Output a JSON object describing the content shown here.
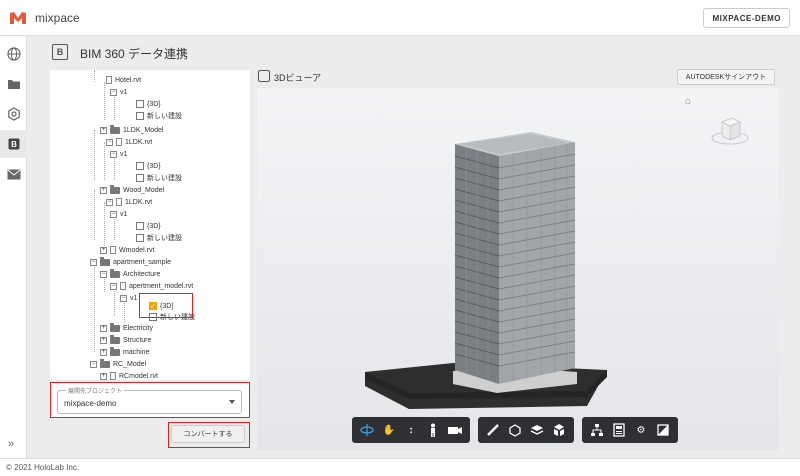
{
  "app": {
    "name": "mixpace",
    "account_button": "MIXPACE-DEMO"
  },
  "rail": {
    "items": [
      "globe-icon",
      "folder-icon",
      "settings-icon",
      "bim360-icon",
      "mail-icon"
    ],
    "expand_label": "»"
  },
  "page": {
    "icon_letter": "B",
    "title": "BIM 360 データ連携"
  },
  "tree": {
    "rows": [
      {
        "kind": "file",
        "label": "Hotel.rvt"
      },
      {
        "kind": "version",
        "label": "v1"
      },
      {
        "kind": "check",
        "label": "{3D}"
      },
      {
        "kind": "check",
        "label": "新しい建設"
      },
      {
        "kind": "folder",
        "label": "1LDK_Model"
      },
      {
        "kind": "file",
        "label": "1LDK.rvt"
      },
      {
        "kind": "version",
        "label": "v1"
      },
      {
        "kind": "check",
        "label": "{3D}"
      },
      {
        "kind": "check",
        "label": "新しい建設"
      },
      {
        "kind": "folder",
        "label": "Wood_Model"
      },
      {
        "kind": "file",
        "label": "1LDK.rvt"
      },
      {
        "kind": "version",
        "label": "v1"
      },
      {
        "kind": "check",
        "label": "{3D}"
      },
      {
        "kind": "check",
        "label": "新しい建設"
      },
      {
        "kind": "file",
        "label": "Wmodel.rvt"
      },
      {
        "kind": "folder",
        "label": "apartment_sample"
      },
      {
        "kind": "folder",
        "label": "Architecture"
      },
      {
        "kind": "file",
        "label": "apertment_model.rvt"
      },
      {
        "kind": "version",
        "label": "v1"
      },
      {
        "kind": "check",
        "label": "{3D}",
        "checked": true
      },
      {
        "kind": "check",
        "label": "新しい建設"
      },
      {
        "kind": "folder",
        "label": "Electricity"
      },
      {
        "kind": "folder",
        "label": "Structure"
      },
      {
        "kind": "folder",
        "label": "machine"
      },
      {
        "kind": "folder",
        "label": "RC_Model"
      },
      {
        "kind": "file",
        "label": "RCmodel.rvt"
      }
    ]
  },
  "project": {
    "label": "展開先プロジェクト",
    "value": "mixpace-demo"
  },
  "convert_button": "コンバートする",
  "viewer": {
    "title": "3Dビューア",
    "signout_button": "AUTODESKサインアウト"
  },
  "toolbar": {
    "group1": [
      "orbit-icon",
      "pan-icon",
      "zoom-icon",
      "first-person-icon",
      "camera-icon"
    ],
    "group2": [
      "measure-icon",
      "section-icon",
      "layers-icon",
      "explode-icon"
    ],
    "group3": [
      "model-browser-icon",
      "properties-icon",
      "settings-icon",
      "fullscreen-icon"
    ]
  },
  "footer": {
    "copyright": "© 2021 HoloLab Inc."
  },
  "colors": {
    "accent": "#f2a100",
    "highlight": "#dd2222",
    "toolbar_bg": "#2f3033",
    "brand": "#e8573c"
  }
}
